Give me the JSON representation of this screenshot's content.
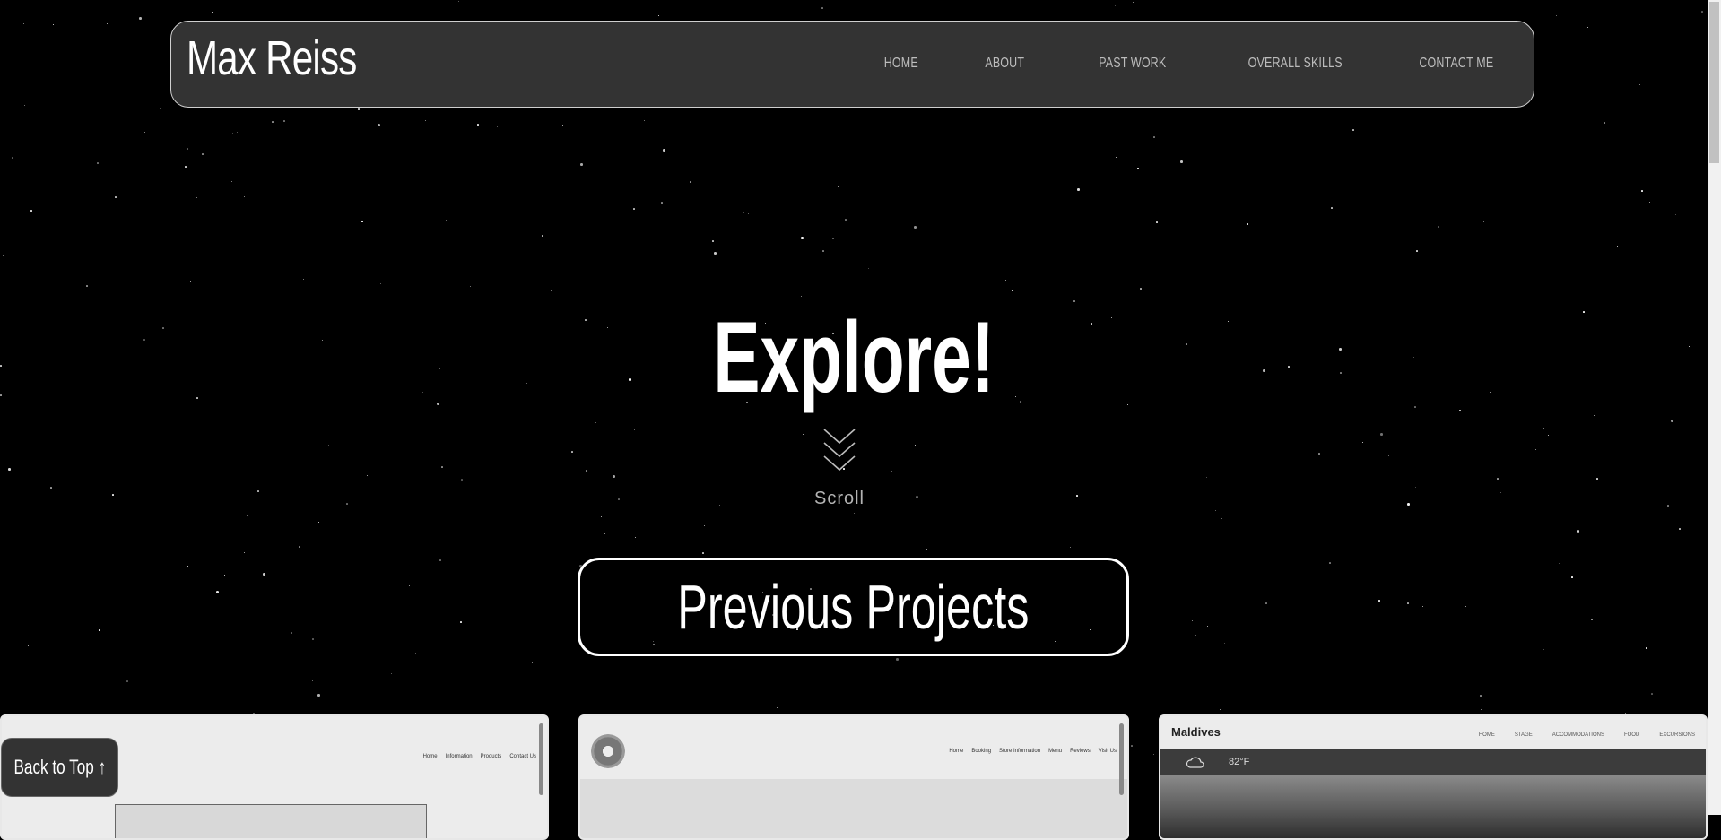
{
  "brand": {
    "name": "Max Reiss"
  },
  "nav": {
    "items": [
      {
        "label": "HOME"
      },
      {
        "label": "ABOUT"
      },
      {
        "label": "PAST WORK"
      },
      {
        "label": "OVERALL SKILLS"
      },
      {
        "label": "CONTACT ME"
      }
    ]
  },
  "hero": {
    "title": "Explore!",
    "scroll_label": "Scroll"
  },
  "projects": {
    "heading": "Previous Projects",
    "cards": [
      {
        "nav": [
          "Home",
          "Information",
          "Products",
          "Contact Us"
        ]
      },
      {
        "nav": [
          "Home",
          "Booking",
          "Store Information",
          "Menu",
          "Reviews",
          "Visit Us"
        ]
      },
      {
        "logo": "Maldives",
        "nav": [
          "HOME",
          "STAGE",
          "ACCOMMODATIONS",
          "FOOD",
          "EXCURSIONS"
        ],
        "temp": "82°F"
      }
    ]
  },
  "back_to_top": {
    "label": "Back to Top ↑"
  },
  "colors": {
    "background": "#000000",
    "navbar": "#333333",
    "accent": "#ffffff"
  }
}
